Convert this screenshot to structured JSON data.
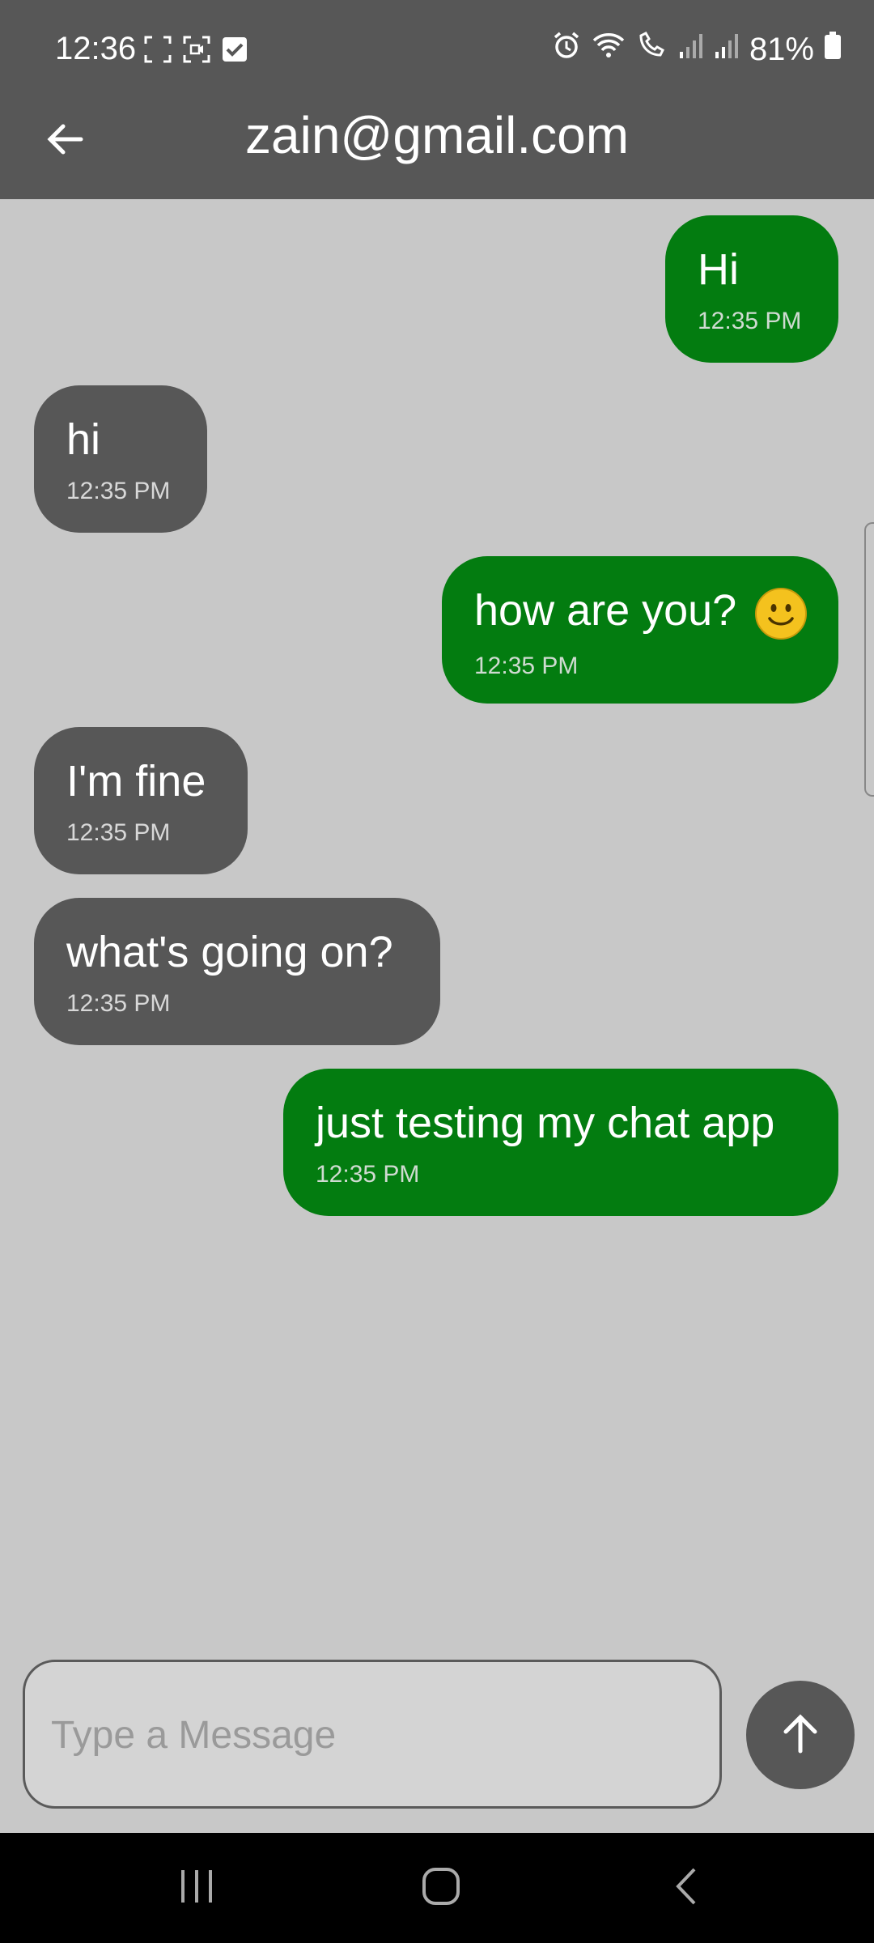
{
  "status_bar": {
    "time": "12:36",
    "battery": "81%",
    "left_icons": [
      "screenshot-icon",
      "screen-record-icon",
      "checkbox-icon"
    ],
    "right_icons": [
      "alarm-icon",
      "wifi-icon",
      "wifi-call-icon",
      "signal-icon",
      "signal-icon",
      "battery-icon"
    ]
  },
  "header": {
    "title": "zain@gmail.com",
    "back_icon": "arrow-left-icon"
  },
  "messages": [
    {
      "direction": "sent",
      "text": "Hi",
      "time": "12:35 PM"
    },
    {
      "direction": "received",
      "text": "hi",
      "time": "12:35 PM"
    },
    {
      "direction": "sent",
      "text": "how are you?",
      "emoji": "smiley-emoji",
      "time": "12:35 PM"
    },
    {
      "direction": "received",
      "text": "I'm fine",
      "time": "12:35 PM"
    },
    {
      "direction": "received",
      "text": "what's going on?",
      "time": "12:35 PM"
    },
    {
      "direction": "sent",
      "text": "just testing my chat app",
      "time": "12:35 PM"
    }
  ],
  "composer": {
    "placeholder": "Type a Message",
    "value": "",
    "send_icon": "arrow-up-icon"
  },
  "colors": {
    "sent_bubble": "#037c10",
    "received_bubble": "#575757",
    "background": "#c8c8c8",
    "bars": "#575757"
  },
  "nav_bar": {
    "icons": [
      "recent-apps-icon",
      "home-icon",
      "back-icon"
    ]
  }
}
